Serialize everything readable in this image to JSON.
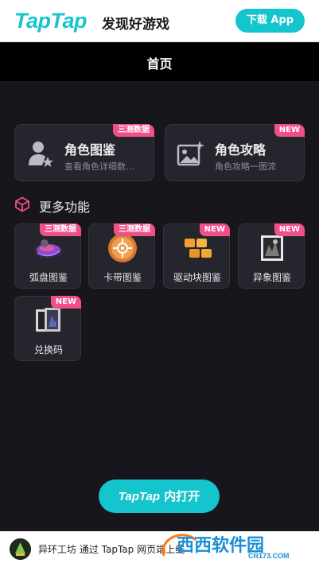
{
  "banner": {
    "logo": "TapTap",
    "slogan": "发现好游戏",
    "download_label": "下载 App"
  },
  "header": {
    "title": "首页"
  },
  "cards": [
    {
      "title": "角色图鉴",
      "subtitle": "查看角色详细数…",
      "badge": "三测数据",
      "icon": "person-star-icon"
    },
    {
      "title": "角色攻略",
      "subtitle": "角色攻略一图流",
      "badge": "NEW",
      "icon": "image-sparkle-icon"
    }
  ],
  "section": {
    "title": "更多功能",
    "icon": "cube-icon"
  },
  "features": [
    {
      "label": "弧盘图鉴",
      "badge": "三测数据",
      "icon": "arc-disc-icon"
    },
    {
      "label": "卡带图鉴",
      "badge": "三测数据",
      "icon": "cassette-icon"
    },
    {
      "label": "驱动块图鉴",
      "badge": "NEW",
      "icon": "drive-block-icon"
    },
    {
      "label": "异象图鉴",
      "badge": "NEW",
      "icon": "anomaly-icon"
    },
    {
      "label": "兑换码",
      "badge": "NEW",
      "icon": "redeem-code-icon"
    }
  ],
  "open_button": {
    "brand": "TapTap",
    "suffix": " 内打开"
  },
  "footer": {
    "text": "异环工坊 通过 TapTap 网页端上线"
  },
  "watermark": {
    "brand": "西西软件园",
    "url": "CR173.COM"
  },
  "colors": {
    "accent": "#15c5ce",
    "badge": "#f0508a",
    "background": "#16161c",
    "card": "#25262d"
  }
}
